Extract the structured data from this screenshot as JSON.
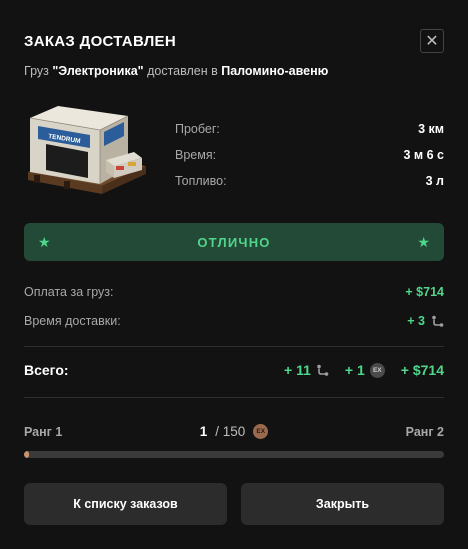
{
  "header": {
    "title": "ЗАКАЗ ДОСТАВЛЕН",
    "close_icon": "close-icon"
  },
  "subtitle": {
    "prefix": "Груз ",
    "cargo_name": "\"Электроника\"",
    "middle": " доставлен в ",
    "destination": "Паломино-авеню"
  },
  "cargo_image": {
    "icon": "cargo-crate-icon",
    "crate_brand": "TENDRUM"
  },
  "stats": [
    {
      "label": "Пробег:",
      "value": "3 км"
    },
    {
      "label": "Время:",
      "value": "3 м 6 с"
    },
    {
      "label": "Топливо:",
      "value": "3 л"
    }
  ],
  "rating": {
    "label": "ОТЛИЧНО",
    "icon": "star-icon",
    "color": "#4fd68a"
  },
  "payment": {
    "cargo_label": "Оплата за груз:",
    "cargo_value": "+ $714",
    "time_label": "Время доставки:",
    "time_value": "+ 3",
    "time_icon": "route-icon"
  },
  "total": {
    "label": "Всего:",
    "route_points": "+ 11",
    "ex_points": "+ 1",
    "ex_badge": "EX",
    "money": "+ $714"
  },
  "rank": {
    "left": "Ранг 1",
    "current": "1",
    "separator": "/ 150",
    "badge": "EX",
    "right": "Ранг 2",
    "progress_fraction": 0.0067
  },
  "buttons": {
    "orders": "К списку заказов",
    "close": "Закрыть"
  }
}
